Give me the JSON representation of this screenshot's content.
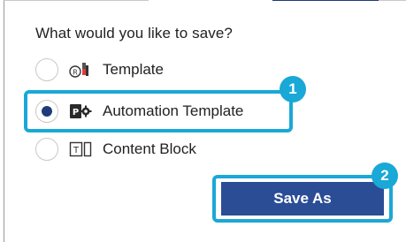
{
  "dialog": {
    "heading": "What would you like to save?",
    "options": [
      {
        "label": "Template",
        "icon": "template-icon",
        "selected": false
      },
      {
        "label": "Automation Template",
        "icon": "automation-template-icon",
        "selected": true
      },
      {
        "label": "Content Block",
        "icon": "content-block-icon",
        "selected": false
      }
    ],
    "save_as_label": "Save As"
  },
  "callouts": {
    "first": "1",
    "second": "2"
  },
  "colors": {
    "accent_highlight": "#1aa8d6",
    "primary_button": "#2b4d96",
    "radio_selected": "#1f3b7a"
  }
}
